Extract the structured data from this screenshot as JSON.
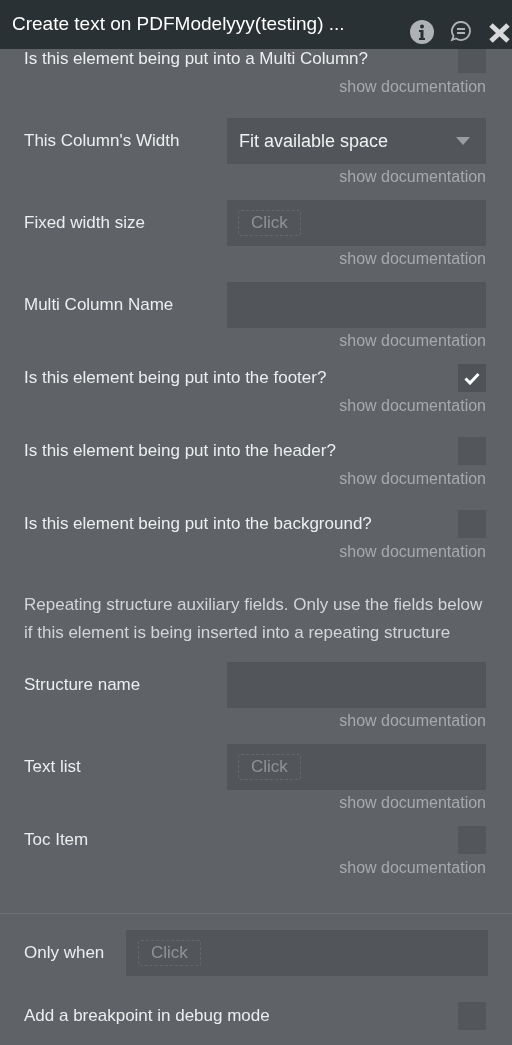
{
  "window": {
    "title": "Create text on PDFModelyyy(testing) ..."
  },
  "properties": [
    {
      "kind": "checkbox",
      "label": "Is this element being put into a Multi Column?",
      "checked": false,
      "doc_link": "show documentation"
    },
    {
      "kind": "dropdown",
      "label": "This Column's Width",
      "value": "Fit available space",
      "doc_link": "show documentation"
    },
    {
      "kind": "expression",
      "label": "Fixed width size",
      "button": "Click",
      "doc_link": "show documentation"
    },
    {
      "kind": "field",
      "label": "Multi Column Name",
      "doc_link": "show documentation"
    },
    {
      "kind": "checkbox",
      "label": "Is this element being put into the footer?",
      "checked": true,
      "doc_link": "show documentation"
    },
    {
      "kind": "checkbox",
      "label": "Is this element being put into the header?",
      "checked": false,
      "doc_link": "show documentation"
    },
    {
      "kind": "checkbox",
      "label": "Is this element being put into the background?",
      "checked": false,
      "doc_link": "show documentation"
    },
    {
      "kind": "note",
      "label": "Repeating structure auxiliary fields. Only use the fields below if this element is being inserted into a repeating structure"
    },
    {
      "kind": "field",
      "label": "Structure name",
      "doc_link": "show documentation"
    },
    {
      "kind": "expression",
      "label": "Text list",
      "button": "Click",
      "doc_link": "show documentation"
    },
    {
      "kind": "checkbox",
      "label": "Toc Item",
      "checked": false,
      "doc_link": "show documentation"
    }
  ],
  "conditions": {
    "only_when": {
      "label": "Only when",
      "button": "Click"
    },
    "breakpoint": {
      "label": "Add a breakpoint in debug mode",
      "checked": false
    }
  }
}
